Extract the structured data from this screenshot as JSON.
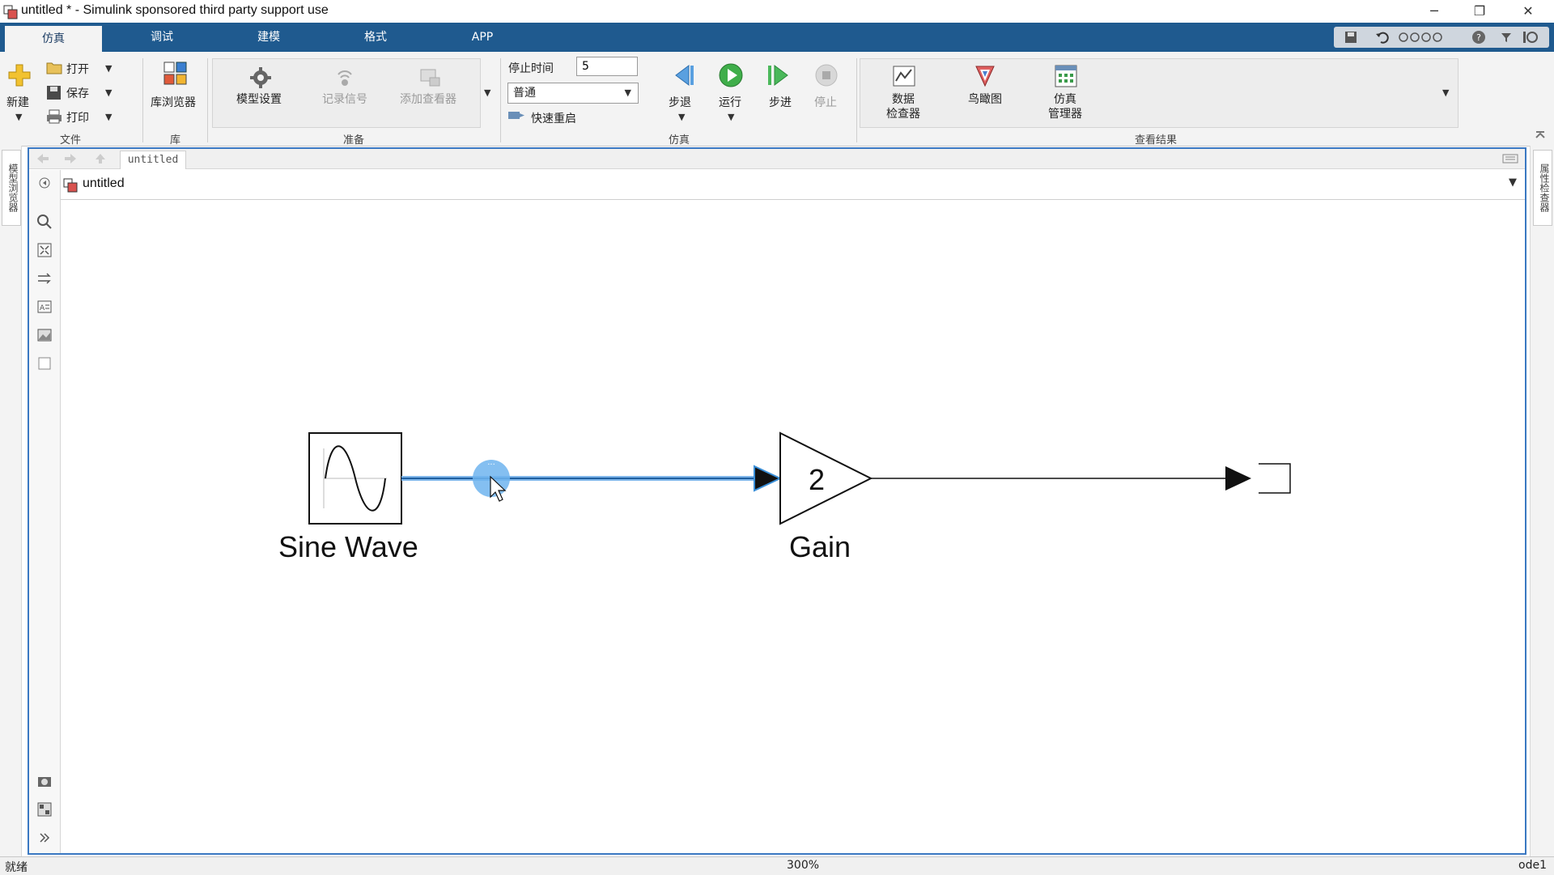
{
  "window": {
    "title": "untitled * - Simulink sponsored third party support use",
    "minimize": "─",
    "restore": "❐",
    "close": "✕"
  },
  "tabs": [
    "仿真",
    "调试",
    "建模",
    "格式",
    "APP"
  ],
  "ribbon": {
    "file": {
      "new": "新建",
      "open": "打开",
      "save": "保存",
      "print": "打印",
      "group": "文件"
    },
    "library": {
      "browser": "库浏览器",
      "group": "库"
    },
    "prepare": {
      "model_settings": "模型设置",
      "log_signals": "记录信号",
      "add_viewer": "添加查看器",
      "group": "准备"
    },
    "simulate": {
      "stop_time_label": "停止时间",
      "stop_time_value": "5",
      "mode": "普通",
      "fast_restart": "快速重启",
      "step_back": "步退",
      "run": "运行",
      "step_forward": "步进",
      "stop": "停止",
      "group": "仿真"
    },
    "review": {
      "data_inspector_l1": "数据",
      "data_inspector_l2": "检查器",
      "birds_eye": "鸟瞰图",
      "sim_manager_l1": "仿真",
      "sim_manager_l2": "管理器",
      "group": "查看结果"
    }
  },
  "side_panels": {
    "left": "模型浏览器",
    "right": "属性检查器"
  },
  "editor": {
    "model_tab": "untitled",
    "address": "untitled"
  },
  "blocks": {
    "sine_wave": {
      "label": "Sine  Wave"
    },
    "gain": {
      "label": "Gain",
      "value": "2"
    }
  },
  "status": {
    "state": "就绪",
    "zoom": "300%",
    "solver": "ode1"
  },
  "colors": {
    "tab_bar": "#1f5a8f",
    "selection": "#3a8fd8",
    "editor_border": "#3a78c2"
  }
}
